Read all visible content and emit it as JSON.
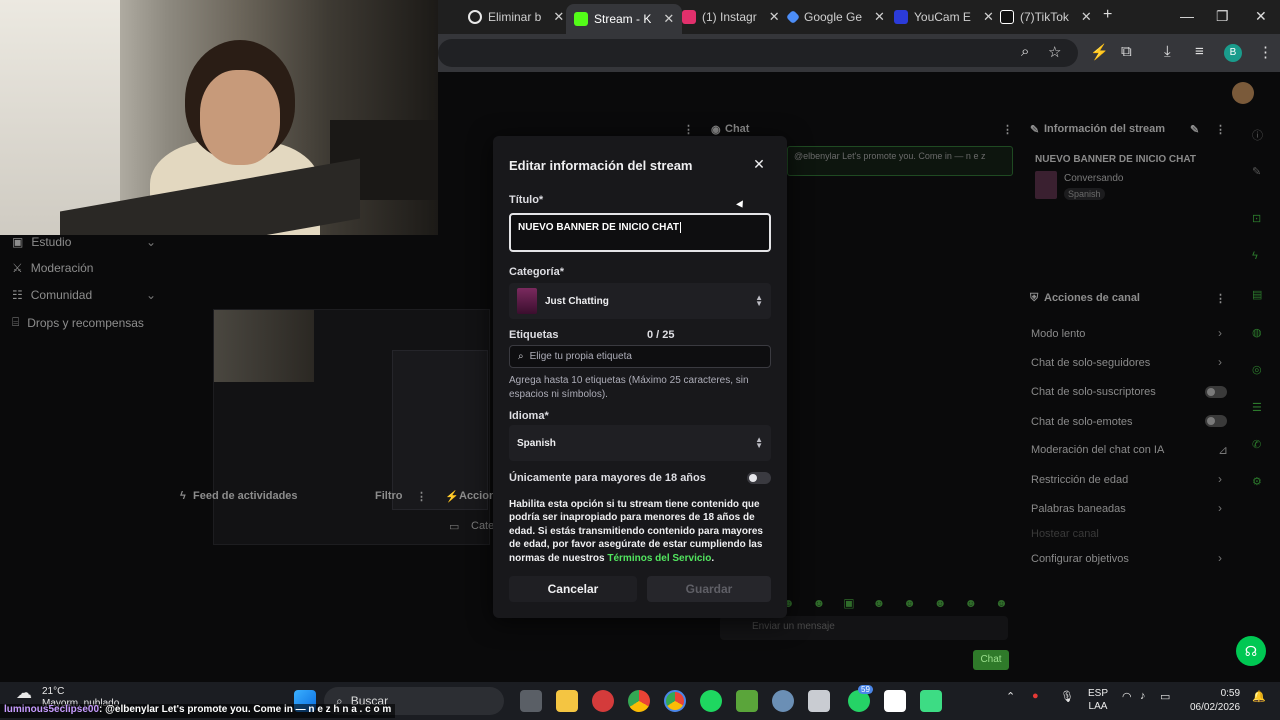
{
  "browser": {
    "tabs": [
      {
        "title": "Eliminar b",
        "favicon_color": "#e8e8e8",
        "active": false
      },
      {
        "title": "Stream - K",
        "favicon_color": "#53fc18",
        "active": true
      },
      {
        "title": "(1) Instagr",
        "favicon_color": "#e1306c",
        "active": false
      },
      {
        "title": "Google Ge",
        "favicon_color": "#4c8df6",
        "active": false
      },
      {
        "title": "YouCam E",
        "favicon_color": "#2b3bd9",
        "active": false
      },
      {
        "title": "(7)TikTok",
        "favicon_color": "#ffffff",
        "active": false
      }
    ],
    "new_tab": "+",
    "profile_initial": "B"
  },
  "sidebar": {
    "items": [
      {
        "label": "Estudio"
      },
      {
        "label": "Moderación"
      },
      {
        "label": "Comunidad"
      },
      {
        "label": "Drops y recompensas"
      }
    ]
  },
  "chat_panel": {
    "header": "Chat",
    "message": "@elbenylar Let's promote you. Come in — n e z",
    "input_placeholder": "Enviar un mensaje",
    "send_label": "Chat"
  },
  "stream_info": {
    "header": "Información del stream",
    "title": "NUEVO BANNER DE INICIO CHAT",
    "category": "Conversando",
    "language": "Spanish"
  },
  "channel_actions": {
    "header": "Acciones de canal",
    "items": [
      {
        "label": "Modo lento",
        "control": "chevron"
      },
      {
        "label": "Chat de solo-seguidores",
        "control": "chevron"
      },
      {
        "label": "Chat de solo-suscriptores",
        "control": "toggle"
      },
      {
        "label": "Chat de solo-emotes",
        "control": "toggle"
      },
      {
        "label": "Moderación del chat con IA",
        "control": "chart"
      },
      {
        "label": "Restricción de edad",
        "control": "chevron"
      },
      {
        "label": "Palabras baneadas",
        "control": "chevron"
      },
      {
        "label": "Hostear canal",
        "control": "none"
      },
      {
        "label": "Configurar objetivos",
        "control": "chevron"
      }
    ]
  },
  "activity_feed": {
    "header": "Feed de actividades",
    "filter_label": "Filtro",
    "actions_header": "Accione",
    "category_label": "Cate"
  },
  "modal": {
    "title": "Editar información del stream",
    "title_label": "Título*",
    "title_value": "NUEVO BANNER DE INICIO CHAT",
    "category_label": "Categoría*",
    "category_value": "Just Chatting",
    "tags_label": "Etiquetas",
    "tags_count": "0 / 25",
    "tags_placeholder": "Elige tu propia etiqueta",
    "tags_help": "Agrega hasta 10 etiquetas (Máximo 25 caracteres, sin espacios ni símbolos).",
    "language_label": "Idioma*",
    "language_value": "Spanish",
    "adult_label": "Únicamente para mayores de 18 años",
    "adult_enabled": false,
    "adult_desc": "Habilita esta opción si tu stream tiene contenido que podría ser inapropiado para menores de 18 años de edad. Si estás transmitiendo contenido para mayores de edad, por favor asegúrate de estar cumpliendo las normas de nuestros",
    "terms_link": "Términos del Servicio",
    "terms_suffix": ".",
    "cancel_label": "Cancelar",
    "save_label": "Guardar",
    "accent_color": "#52e55f"
  },
  "taskbar": {
    "weather_temp": "21°C",
    "weather_desc": "Mayorm. nublado",
    "search_label": "Buscar",
    "badge_count": "59",
    "lang_top": "ESP",
    "lang_bottom": "LAA",
    "time": "0:59",
    "date": "06/02/2026"
  },
  "ticker": {
    "nick": "luminous5eclipse00",
    "message": ": @elbenylar Let's promote you. Come in — n e z h n a . c o m"
  }
}
